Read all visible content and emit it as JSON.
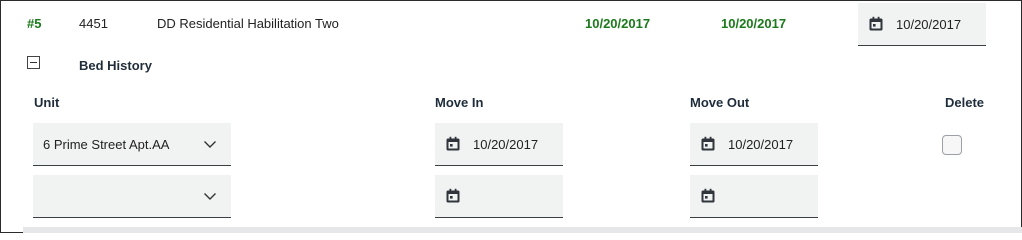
{
  "record": {
    "number": "#5",
    "id": "4451",
    "name": "DD Residential Habilitation Two",
    "date_1": "10/20/2017",
    "date_2": "10/20/2017",
    "date_field_value": "10/20/2017"
  },
  "bed_history": {
    "title": "Bed History",
    "columns": {
      "unit": "Unit",
      "move_in": "Move In",
      "move_out": "Move Out",
      "delete": "Delete"
    },
    "rows": [
      {
        "unit": "6 Prime Street Apt.AA",
        "move_in": "10/20/2017",
        "move_out": "10/20/2017",
        "delete_checked": false
      },
      {
        "unit": "",
        "move_in": "",
        "move_out": ""
      }
    ]
  },
  "colors": {
    "accent_green": "#1b7a1b",
    "field_bg": "#f1f2f2",
    "header_text": "#1f2d3a"
  },
  "icons": {
    "calendar": "calendar-icon",
    "chevron": "chevron-down-icon",
    "collapse": "minus-square-icon"
  }
}
